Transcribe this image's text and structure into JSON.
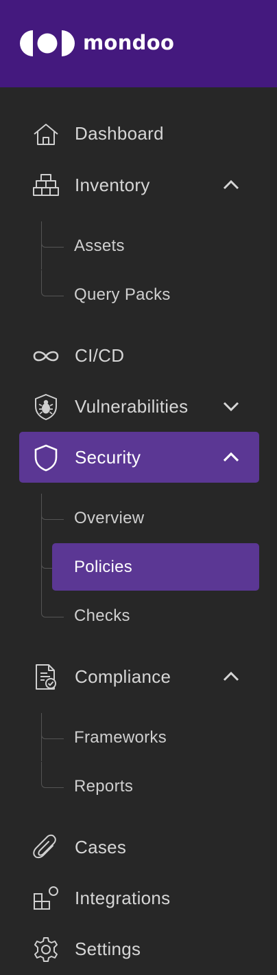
{
  "brand": {
    "name": "mondoo",
    "logo_icon": "mondoo-logo-icon",
    "header_color": "#44197e"
  },
  "nav": {
    "dashboard": {
      "label": "Dashboard",
      "icon": "home-icon"
    },
    "inventory": {
      "label": "Inventory",
      "icon": "stack-icon",
      "expanded": true,
      "children": {
        "assets": "Assets",
        "query_packs": "Query Packs"
      }
    },
    "cicd": {
      "label": "CI/CD",
      "icon": "infinity-icon"
    },
    "vulnerabilities": {
      "label": "Vulnerabilities",
      "icon": "shield-bug-icon",
      "expanded": false
    },
    "security": {
      "label": "Security",
      "icon": "shield-icon",
      "expanded": true,
      "active": true,
      "children": {
        "overview": "Overview",
        "policies": "Policies",
        "checks": "Checks"
      },
      "active_child": "Policies"
    },
    "compliance": {
      "label": "Compliance",
      "icon": "document-check-icon",
      "expanded": true,
      "children": {
        "frameworks": "Frameworks",
        "reports": "Reports"
      }
    },
    "cases": {
      "label": "Cases",
      "icon": "paperclip-icon"
    },
    "integrations": {
      "label": "Integrations",
      "icon": "integrations-icon"
    },
    "settings": {
      "label": "Settings",
      "icon": "gear-icon"
    }
  },
  "colors": {
    "background": "#272727",
    "active": "#5b3794",
    "text": "#d6d6d6"
  }
}
